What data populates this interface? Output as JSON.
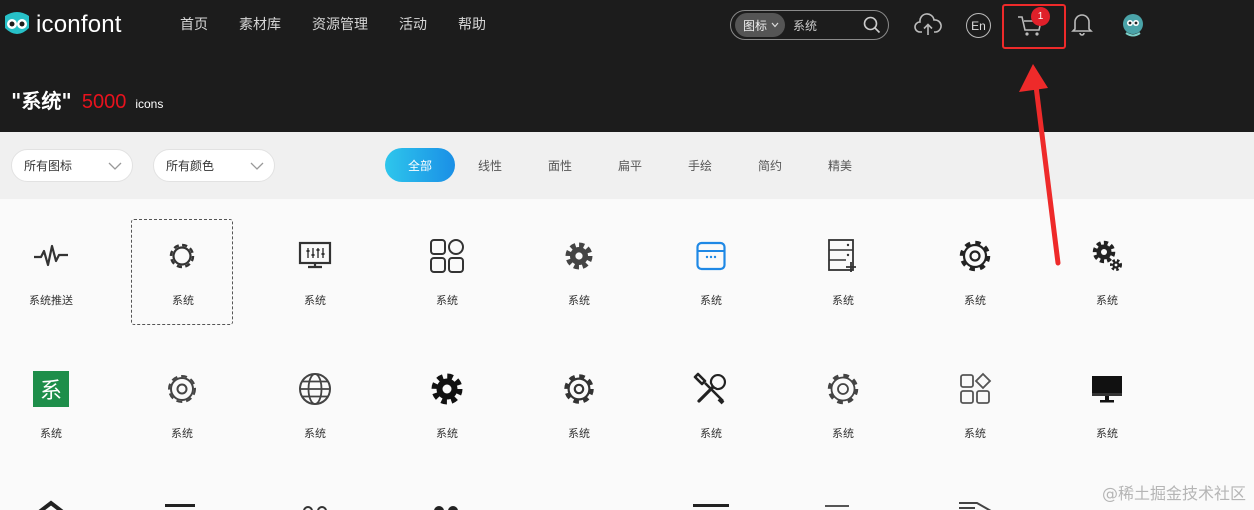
{
  "brand": {
    "name": "iconfont"
  },
  "nav": {
    "items": [
      "首页",
      "素材库",
      "资源管理",
      "活动",
      "帮助"
    ]
  },
  "search": {
    "scope": "图标",
    "value": "系统",
    "placeholder": "系统"
  },
  "header": {
    "lang_label": "En",
    "cart_count": "1"
  },
  "heading": {
    "query": "\"系统\"",
    "count": "5000",
    "unit": "icons"
  },
  "filters": {
    "icon_select": "所有图标",
    "color_select": "所有颜色",
    "tabs": [
      "全部",
      "线性",
      "面性",
      "扁平",
      "手绘",
      "简约",
      "精美"
    ],
    "active_tab": "全部"
  },
  "grid": {
    "row1": [
      {
        "icon": "pulse-icon",
        "label": "系统推送"
      },
      {
        "icon": "gear-outline-icon",
        "label": "系统",
        "selected": true
      },
      {
        "icon": "monitor-sliders-icon",
        "label": "系统"
      },
      {
        "icon": "app-grid-icon",
        "label": "系统"
      },
      {
        "icon": "gear-filled-icon",
        "label": "系统"
      },
      {
        "icon": "browser-window-icon",
        "label": "系统",
        "color": "#1e88e5"
      },
      {
        "icon": "server-add-icon",
        "label": "系统"
      },
      {
        "icon": "cog-outline-icon",
        "label": "系统"
      },
      {
        "icon": "gears-icon",
        "label": "系统"
      }
    ],
    "row2": [
      {
        "icon": "xi-badge-icon",
        "label": "系统",
        "glyph": "系",
        "color": "#1e8e4a"
      },
      {
        "icon": "gear-hex-icon",
        "label": "系统"
      },
      {
        "icon": "globe-icon",
        "label": "系统"
      },
      {
        "icon": "gear-solid-icon",
        "label": "系统"
      },
      {
        "icon": "gear-round-icon",
        "label": "系统"
      },
      {
        "icon": "tools-icon",
        "label": "系统"
      },
      {
        "icon": "gear-thin-icon",
        "label": "系统"
      },
      {
        "icon": "four-squares-icon",
        "label": "系统"
      },
      {
        "icon": "desktop-icon",
        "label": "系统"
      }
    ]
  },
  "watermark": "@稀土掘金技术社区",
  "colors": {
    "accent_gradient": [
      "#2ec6ec",
      "#1a8fe6"
    ],
    "count_red": "#e8121d",
    "annotation_red": "#ee2a2a"
  }
}
